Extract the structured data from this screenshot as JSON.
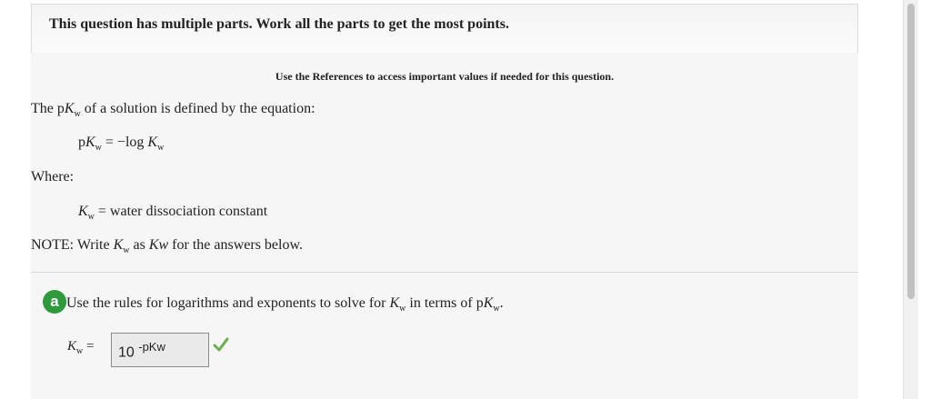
{
  "header": {
    "text": "This question has multiple parts. Work all the parts to get the most points."
  },
  "references": "Use the References to access important values if needed for this question.",
  "intro": {
    "text_before": "The",
    "p": "p",
    "K": "K",
    "sub_w": "w",
    "text_after": "of a solution is defined by the equation:"
  },
  "equation": {
    "p": "p",
    "K": "K",
    "sub_w": "w",
    "equals_log": "= −log",
    "K2": "K",
    "sub_w2": "w"
  },
  "where_label": "Where:",
  "definition": {
    "K": "K",
    "sub_w": "w",
    "text": "= water dissociation constant"
  },
  "note": {
    "prefix": "NOTE: Write",
    "K": "K",
    "sub_w": "w",
    "as": "as",
    "kw_italic": "Kw",
    "suffix": "for the answers below."
  },
  "part_a": {
    "badge": "a",
    "prompt_prefix": "Use the rules for logarithms and exponents to solve for",
    "K": "K",
    "sub_w": "w",
    "prompt_middle": "in terms of",
    "p": "p",
    "K2": "K",
    "sub_w2": "w",
    "period": ".",
    "answer_label_K": "K",
    "answer_label_sub": "w",
    "answer_label_eq": "=",
    "answer_base": "10",
    "answer_exponent": "-pKw",
    "correct_icon": "checkmark-icon",
    "check_color": "#6ab04c"
  }
}
